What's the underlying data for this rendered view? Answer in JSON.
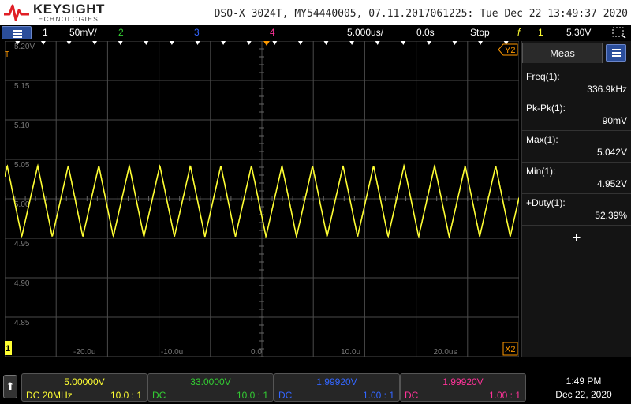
{
  "header": {
    "brand": "KEYSIGHT",
    "brand_sub": "TECHNOLOGIES",
    "title": "DSO-X 3024T, MY54440005, 07.11.2017061225: Tue Dec 22 13:49:37 2020"
  },
  "status": {
    "ch1_num": "1",
    "ch1_scale": "50mV/",
    "ch2_num": "2",
    "ch3_num": "3",
    "ch4_num": "4",
    "timebase": "5.000us/",
    "delay": "0.0s",
    "run_state": "Stop",
    "trigger_icon": "f",
    "trigger_source": "1",
    "trigger_level": "5.30V"
  },
  "grid": {
    "y_labels": [
      "5.20V",
      "5.15",
      "5.10",
      "5.05",
      "5.00",
      "4.95",
      "4.90",
      "4.85"
    ],
    "x_labels": [
      "-20.0u",
      "-10.0u",
      "0.0",
      "10.0u",
      "20.0us"
    ],
    "cursor_y2": "Y2",
    "cursor_x2": "X2",
    "ch1_marker": "1",
    "t_marker": "T"
  },
  "chart_data": {
    "type": "line",
    "series": [
      {
        "waveform": "triangle",
        "frequency_hz": 336900,
        "v_min": 4.952,
        "v_max": 5.042,
        "duty_percent": 52.39
      }
    ],
    "x_range_us": [
      -25,
      25
    ],
    "y_range_v": [
      4.8,
      5.2
    ]
  },
  "meas_panel": {
    "tab_label": "Meas",
    "items": [
      {
        "label": "Freq(1):",
        "value": "336.9kHz"
      },
      {
        "label": "Pk-Pk(1):",
        "value": "90mV"
      },
      {
        "label": "Max(1):",
        "value": "5.042V"
      },
      {
        "label": "Min(1):",
        "value": "4.952V"
      },
      {
        "label": "+Duty(1):",
        "value": "52.39%"
      }
    ],
    "add_symbol": "+"
  },
  "bottom": {
    "home_symbol": "⬆",
    "channels": [
      {
        "volts": "5.00000V",
        "coupling": "DC 20MHz",
        "probe": "10.0 : 1",
        "color": "#ffff33"
      },
      {
        "volts": "33.0000V",
        "coupling": "DC",
        "probe": "10.0 : 1",
        "color": "#33cc33"
      },
      {
        "volts": "1.99920V",
        "coupling": "DC",
        "probe": "1.00 : 1",
        "color": "#3366ff"
      },
      {
        "volts": "1.99920V",
        "coupling": "DC",
        "probe": "1.00 : 1",
        "color": "#ff3399"
      }
    ],
    "time": "1:49 PM",
    "date": "Dec 22, 2020"
  },
  "colors": {
    "ch1": "#ffff33",
    "ch2": "#33cc33",
    "ch3": "#3366ff",
    "ch4": "#ff3399",
    "trigger_marker": "#ff9900",
    "cursor": "#ff9900"
  }
}
